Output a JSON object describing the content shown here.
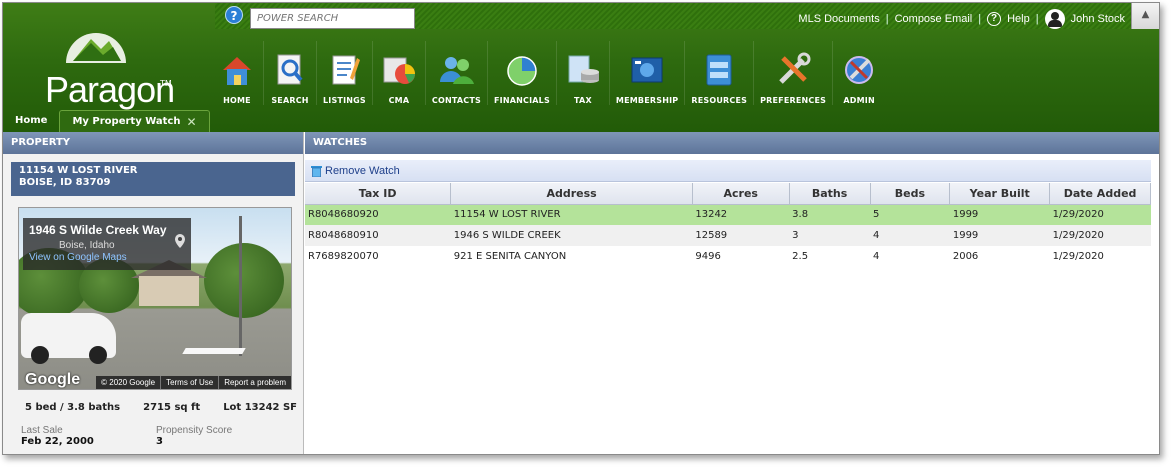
{
  "topbar": {
    "search_placeholder": "POWER SEARCH",
    "links": [
      "MLS Documents",
      "Compose Email",
      "Help"
    ],
    "user": "John Stock",
    "help_glyph": "?",
    "collapse_glyph": "▲"
  },
  "logo": {
    "text": "Paragon",
    "tm": "TM"
  },
  "nav": [
    {
      "label": "HOME",
      "icon": "house-icon"
    },
    {
      "label": "SEARCH",
      "icon": "search-icon"
    },
    {
      "label": "LISTINGS",
      "icon": "listings-icon"
    },
    {
      "label": "CMA",
      "icon": "cma-icon"
    },
    {
      "label": "CONTACTS",
      "icon": "contacts-icon"
    },
    {
      "label": "FINANCIALS",
      "icon": "financials-icon"
    },
    {
      "label": "TAX",
      "icon": "tax-icon"
    },
    {
      "label": "MEMBERSHIP",
      "icon": "membership-icon"
    },
    {
      "label": "RESOURCES",
      "icon": "resources-icon"
    },
    {
      "label": "PREFERENCES",
      "icon": "preferences-icon"
    },
    {
      "label": "ADMIN",
      "icon": "admin-icon"
    }
  ],
  "tabs": {
    "home": "Home",
    "active": "My Property Watch",
    "close": "✕"
  },
  "property": {
    "header": "PROPERTY",
    "address_line1": "11154 W LOST RIVER",
    "address_line2": "BOISE, ID 83709",
    "streetview": {
      "title": "1946 S Wilde Creek Way",
      "subtitle": "Boise, Idaho",
      "link": "View on Google Maps",
      "brand": "Google",
      "credits": [
        "© 2020 Google",
        "Terms of Use",
        "Report a problem"
      ]
    },
    "beds_baths": "5 bed / 3.8 baths",
    "sqft": "2715 sq ft",
    "lot": "Lot  13242 SF",
    "last_sale_label": "Last Sale",
    "last_sale_value": "Feb 22, 2000",
    "propensity_label": "Propensity Score",
    "propensity_value": "3"
  },
  "watches": {
    "header": "WATCHES",
    "remove_label": "Remove Watch",
    "columns": [
      "Tax ID",
      "Address",
      "Acres",
      "Baths",
      "Beds",
      "Year Built",
      "Date Added"
    ],
    "rows": [
      [
        "R8048680920",
        "11154 W LOST RIVER",
        "13242",
        "3.8",
        "5",
        "1999",
        "1/29/2020"
      ],
      [
        "R8048680910",
        "1946 S WILDE CREEK",
        "12589",
        "3",
        "4",
        "1999",
        "1/29/2020"
      ],
      [
        "R7689820070",
        "921 E SENITA CANYON",
        "9496",
        "2.5",
        "4",
        "2006",
        "1/29/2020"
      ]
    ]
  },
  "colors": {
    "header_green": "#2e6a0f",
    "panel_blue": "#5d7499",
    "selected_row": "#b4e39a",
    "link_blue": "#1e3f8a"
  }
}
